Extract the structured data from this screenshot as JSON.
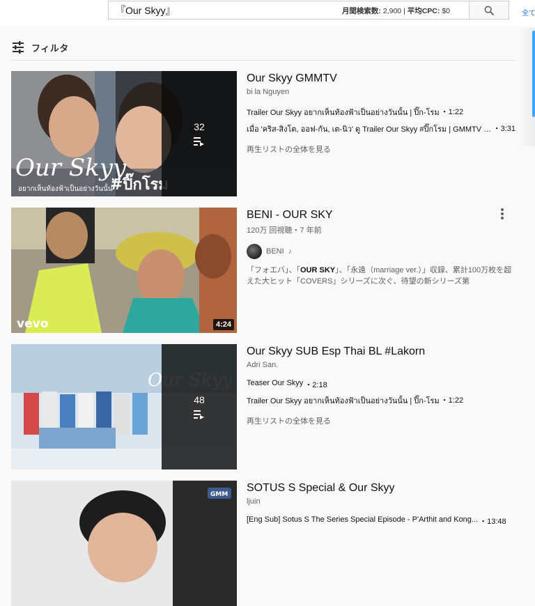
{
  "search": {
    "query": "『Our Skyy』",
    "stats_monthly_label": "月間検索数:",
    "stats_monthly_value": "2,900",
    "stats_sep": "|",
    "stats_cpc_label": "平均CPC:",
    "stats_cpc_value": "$0",
    "right_link": "全て"
  },
  "filter": {
    "label": "フィルタ"
  },
  "results": [
    {
      "kind": "playlist",
      "title": "Our Skyy GMMTV",
      "channel": "bi la Nguyen",
      "count": "32",
      "videos": [
        {
          "title": "Trailer Our Skyy อยากเห็นท้องฟ้าเป็นอย่างวันนั้น | ปิ๊ก-โรม",
          "duration": "・1:22"
        },
        {
          "title": "เมื่อ 'คริส-สิงโต, ออฟ-กัน, เต-นิว' ดู Trailer Our Skyy #ปิ๊กโรม | GMMTV R...",
          "duration": "・3:31"
        }
      ],
      "view_all": "再生リストの全体を見る",
      "thumb_text_1": "Our Skyy",
      "thumb_text_2": "อยากเห็นท้องฟ้าเป็นอย่างวันนั้น",
      "thumb_text_3": "#ปิ๊กโรม"
    },
    {
      "kind": "video",
      "title": "BENI - OUR SKY",
      "meta": "120万 回視聴・7 年前",
      "channel": "BENI",
      "duration": "4:24",
      "desc_pre": "「フォエバ」、「",
      "desc_bold": "OUR SKY",
      "desc_post": "」、「永遠（marriage ver.）」収録、累計100万枚を超えた大ヒット「COVERS」シリーズに次ぐ、待望の新シリーズ第",
      "thumb_logo": "vevo"
    },
    {
      "kind": "playlist",
      "title": "Our Skyy SUB Esp Thai BL #Lakorn",
      "channel": "Adri San.",
      "count": "48",
      "videos": [
        {
          "title": "Teaser Our Skyy",
          "duration": "・2:18"
        },
        {
          "title": "Trailer Our Skyy อยากเห็นท้องฟ้าเป็นอย่างวันนั้น | ปิ๊ก-โรม",
          "duration": "・1:22"
        }
      ],
      "view_all": "再生リストの全体を見る",
      "thumb_text_1": "Our Skyy"
    },
    {
      "kind": "playlist",
      "title": "SOTUS S Special & Our Skyy",
      "channel": "ljuin",
      "videos": [
        {
          "title": "[Eng Sub] Sotus S The Series Special Episode - P'Arthit and Kong...",
          "duration": "・13:48"
        }
      ],
      "thumb_logo": "GMM"
    }
  ],
  "colors": {
    "accent": "#3ea6ff",
    "link": "#1a73e8"
  },
  "icons": {
    "search": "search-icon",
    "filter": "filter-icon",
    "playlist": "playlist-icon",
    "more": "more-vert-icon",
    "music": "music-note-icon"
  }
}
